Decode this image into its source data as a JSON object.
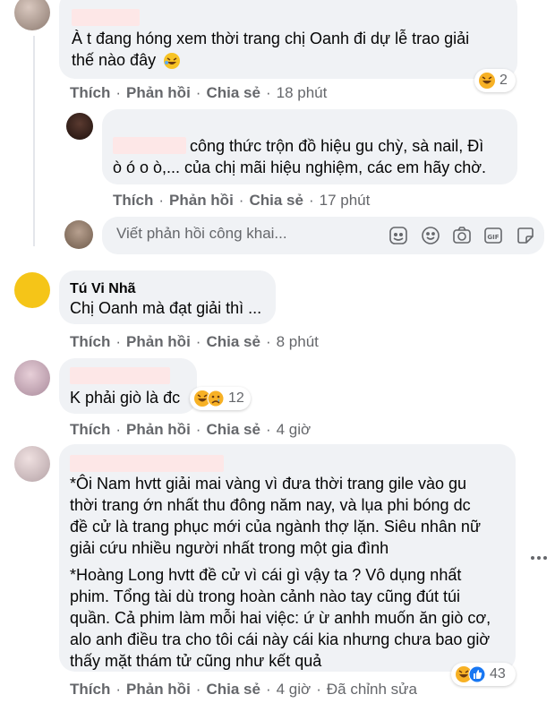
{
  "actions": {
    "like": "Thích",
    "reply": "Phản hồi",
    "share": "Chia sẻ",
    "sep": "·"
  },
  "comments": [
    {
      "text_lines": [
        "À t đang hóng xem thời trang chị Oanh đi dự lễ trao giải",
        "thế nào đây"
      ],
      "time": "18 phút",
      "reaction_count": "2"
    },
    {
      "text_lines": [
        "công thức trộn đồ hiệu gu chỳ, sà nail, Đì",
        "ò ó o ò,... của chị mãi hiệu nghiệm, các em hãy chờ."
      ],
      "time": "17 phút"
    },
    {
      "author": "Tú Vi Nhã",
      "text_lines": [
        "Chị Oanh mà đạt giải thì ..."
      ],
      "time": "8 phút"
    },
    {
      "text_lines": [
        "K phải giò là đc"
      ],
      "time": "4 giờ",
      "reaction_count": "12"
    },
    {
      "text_lines": [
        "*Ôi Nam hvtt giải mai vàng vì đưa thời trang gile vào gu",
        "thời trang ớn nhất thu đông năm nay, và lụa phi bóng dc",
        "đề cử là trang phục mới của ngành thợ lặn. Siêu nhân nữ",
        "giải cứu nhiều người nhất trong một gia đình",
        "*Hoàng Long hvtt đề cử vì cái gì vậy ta ? Vô dụng nhất",
        "phim. Tổng tài dù trong hoàn cảnh nào tay cũng đút túi",
        "quần. Cả phim làm mỗi hai việc: ứ ừ anhh muốn ăn giò cơ,",
        "alo anh điều tra cho tôi cái này cái kia nhưng chưa bao giờ",
        "thấy mặt thám tử cũng như kết quả"
      ],
      "time": "4 giờ",
      "edited": "Đã chỉnh sửa",
      "reaction_count": "43"
    }
  ],
  "reply_box": {
    "placeholder": "Viết phản hồi công khai..."
  },
  "icons": {
    "reply_tools": [
      "sticker-face-icon",
      "emoji-icon",
      "camera-icon",
      "gif-icon",
      "sticker-icon"
    ],
    "more": "more-options-icon"
  },
  "colors": {
    "bubble": "#f0f2f5",
    "meta": "#65676b",
    "like_blue": "#1877f2",
    "haha_yellow": "#f7b125"
  }
}
